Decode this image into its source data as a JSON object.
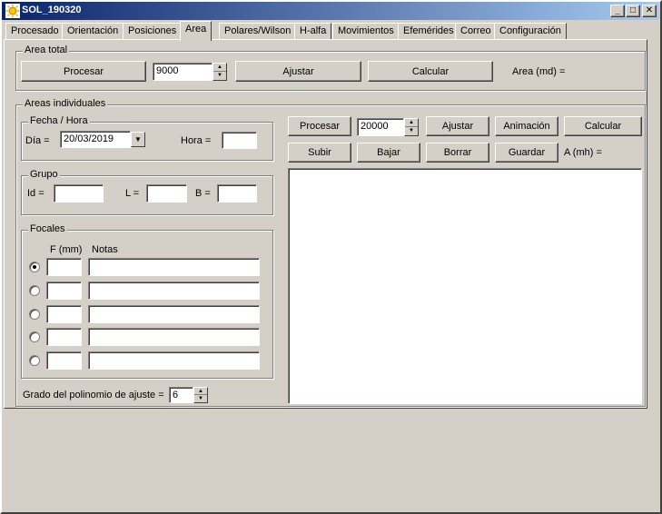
{
  "window": {
    "title": "SOL_190320",
    "minimize": "_",
    "maximize": "□",
    "close": "✕"
  },
  "tabs": [
    "Procesado",
    "Orientación",
    "Posiciones",
    "Area",
    "Polares/Wilson",
    "H-alfa",
    "Movimientos",
    "Efemérides",
    "Correo",
    "Configuración"
  ],
  "active_tab": "Area",
  "area_total": {
    "legend": "Area total",
    "procesar": "Procesar",
    "value": "9000",
    "ajustar": "Ajustar",
    "calcular": "Calcular",
    "result_label": "Area (md) ="
  },
  "areas_individuales": {
    "legend": "Areas individuales",
    "fecha_hora": {
      "legend": "Fecha / Hora",
      "dia_label": "Día =",
      "dia_value": "20/03/2019",
      "hora_label": "Hora =",
      "hora_value": ""
    },
    "grupo": {
      "legend": "Grupo",
      "id_label": "Id =",
      "l_label": "L =",
      "b_label": "B ="
    },
    "focales": {
      "legend": "Focales",
      "col_f": "F (mm)",
      "col_notas": "Notas",
      "selected_row": 0
    },
    "grado_label": "Grado del polinomio de ajuste =",
    "grado_value": "6",
    "procesar": "Procesar",
    "value": "20000",
    "ajustar": "Ajustar",
    "animacion": "Animación",
    "calcular": "Calcular",
    "subir": "Subir",
    "bajar": "Bajar",
    "borrar": "Borrar",
    "guardar": "Guardar",
    "result_label": "A (mh) ="
  },
  "icons": {
    "app": "sun-icon",
    "dropdown": "chevron-down-icon",
    "spin_up": "arrow-up-icon",
    "spin_down": "arrow-down-icon"
  }
}
